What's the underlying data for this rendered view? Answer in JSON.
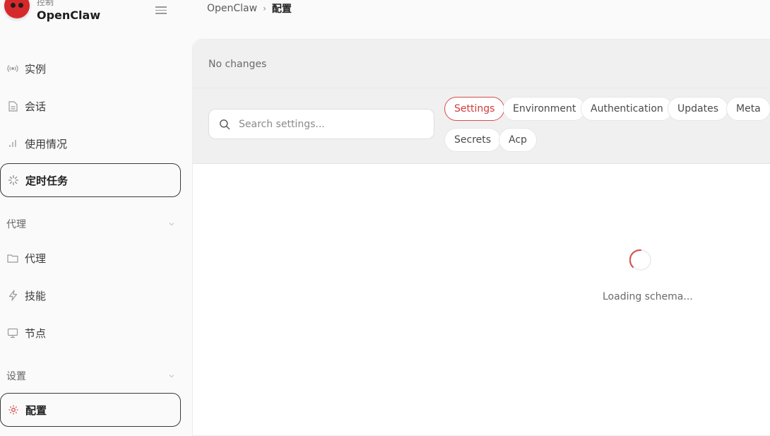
{
  "brand": {
    "subtitle": "控制",
    "name": "OpenClaw"
  },
  "sidebar": {
    "items": [
      {
        "label": "实例",
        "icon": "radio-waves-icon"
      },
      {
        "label": "会话",
        "icon": "document-icon"
      },
      {
        "label": "使用情况",
        "icon": "bar-chart-icon"
      },
      {
        "label": "定时任务",
        "icon": "loader-icon",
        "active": true
      }
    ],
    "sections": [
      {
        "label": "代理",
        "items": [
          {
            "label": "代理",
            "icon": "folder-icon"
          },
          {
            "label": "技能",
            "icon": "lightning-icon"
          },
          {
            "label": "节点",
            "icon": "monitor-icon"
          }
        ]
      },
      {
        "label": "设置",
        "items": [
          {
            "label": "配置",
            "icon": "gear-icon",
            "active": true
          }
        ]
      }
    ]
  },
  "breadcrumb": {
    "root": "OpenClaw",
    "separator": "›",
    "current": "配置"
  },
  "status": {
    "text": "No changes"
  },
  "search": {
    "placeholder": "Search settings..."
  },
  "tabs": [
    {
      "label": "Settings",
      "active": true
    },
    {
      "label": "Environment"
    },
    {
      "label": "Authentication"
    },
    {
      "label": "Updates"
    },
    {
      "label": "Meta"
    },
    {
      "label": "Secrets"
    },
    {
      "label": "Acp"
    }
  ],
  "loading": {
    "text": "Loading schema..."
  },
  "colors": {
    "accent": "#d94b4b",
    "logo": "#d6292b"
  }
}
